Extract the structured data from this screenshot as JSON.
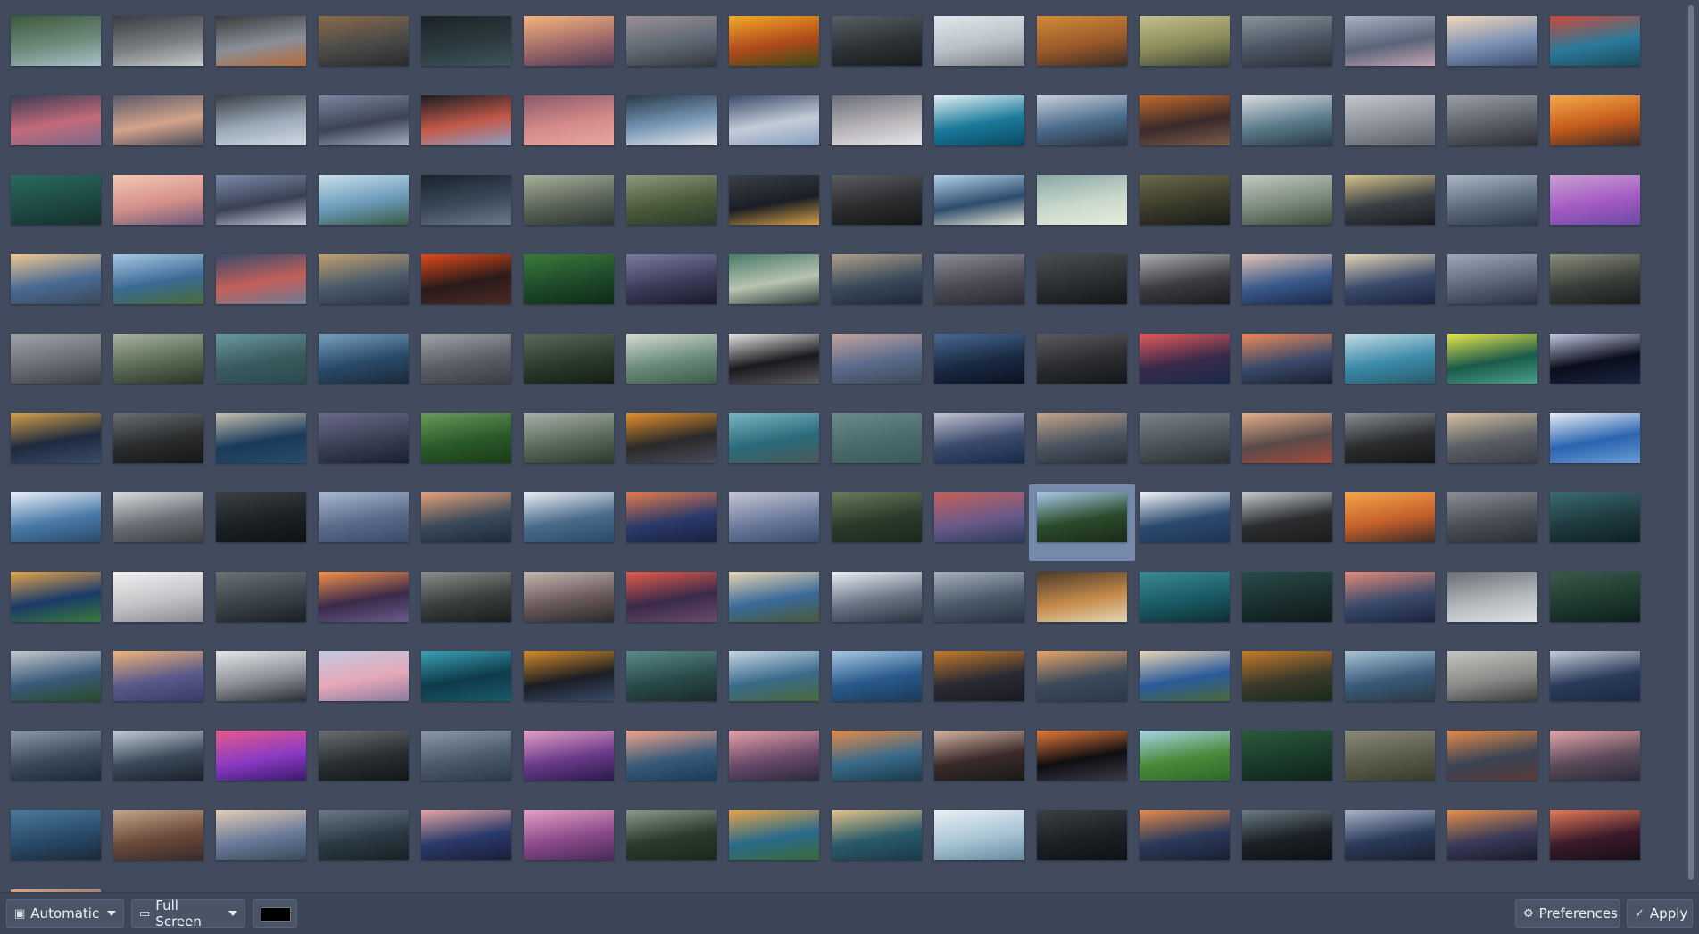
{
  "grid": {
    "selected_index": 106,
    "palette": [
      [
        "#6f8a7c",
        "#3c5a3c",
        "#a9c2c9"
      ],
      [
        "#7a7e82",
        "#3a3c3f",
        "#c9cbcc"
      ],
      [
        "#8a8f98",
        "#3b3a3b",
        "#b56a3a"
      ],
      [
        "#4a4a48",
        "#8a6a48",
        "#2c2a29"
      ],
      [
        "#2c3a40",
        "#1b2427",
        "#3f5459"
      ],
      [
        "#a06a6a",
        "#f4b47c",
        "#4a3a58"
      ],
      [
        "#5e6874",
        "#9a8f94",
        "#34383d"
      ],
      [
        "#b04a1a",
        "#f2a82a",
        "#3a4a1a"
      ],
      [
        "#2d3236",
        "#5a5e62",
        "#1a1c1e"
      ],
      [
        "#b8c0c8",
        "#e2e6ea",
        "#7a7e84"
      ],
      [
        "#9a5a2a",
        "#d48a3a",
        "#3a2c24"
      ],
      [
        "#8a8a5a",
        "#c2c08a",
        "#3c4436"
      ],
      [
        "#4a5460",
        "#8a949e",
        "#2a3038"
      ],
      [
        "#5a6478",
        "#a8b0c4",
        "#c4a4b4"
      ],
      [
        "#7a90b4",
        "#f2d8b8",
        "#3c4c6c"
      ],
      [
        "#2a7a9a",
        "#c84a3a",
        "#1c4a5a"
      ],
      [
        "#c46a7a",
        "#3a3c54",
        "#7a6a8a"
      ],
      [
        "#d4a48a",
        "#5a5a6a",
        "#4a4c5a"
      ],
      [
        "#9aaab8",
        "#3a3e44",
        "#d2dae2"
      ],
      [
        "#3c4454",
        "#7a86a0",
        "#a4aec0"
      ],
      [
        "#c45a4a",
        "#1a1c22",
        "#8aa0c4"
      ],
      [
        "#d48a8a",
        "#8a5a6a",
        "#e8a8a0"
      ],
      [
        "#7a9ab8",
        "#2a3a4a",
        "#e8e6ea"
      ],
      [
        "#c4ccd8",
        "#3a4c6a",
        "#8aa0c0"
      ],
      [
        "#b8b4b8",
        "#6a6e78",
        "#e6e6ea"
      ],
      [
        "#1a7a9a",
        "#e4f0f4",
        "#0a4a64"
      ],
      [
        "#4a6a8a",
        "#c8d0dc",
        "#2a3240"
      ],
      [
        "#3a2a2a",
        "#c46a2a",
        "#7a5a4a"
      ],
      [
        "#5a7a8a",
        "#d8dce0",
        "#2a3a44"
      ],
      [
        "#8a8e96",
        "#c4c8cc",
        "#5a5e66"
      ],
      [
        "#5a5e66",
        "#9a9ea4",
        "#2c2e32"
      ],
      [
        "#c45a1a",
        "#f4a84a",
        "#3a2a2a"
      ],
      [
        "#1e4a44",
        "#2a6a5c",
        "#14302c"
      ],
      [
        "#d4908a",
        "#f4c8b4",
        "#6a5a7a"
      ],
      [
        "#3a4054",
        "#7a8aa8",
        "#c4cad6"
      ],
      [
        "#6a9ab8",
        "#c8e0ec",
        "#3a5a44"
      ],
      [
        "#3a4a5a",
        "#1a222c",
        "#6a7a8a"
      ],
      [
        "#5a6458",
        "#a8b09c",
        "#2c3430"
      ],
      [
        "#4a5a3a",
        "#8a9a7a",
        "#2a3a2a"
      ],
      [
        "#1a1e24",
        "#3a4048",
        "#d4a04a"
      ],
      [
        "#2a2c2e",
        "#5a5c60",
        "#141618"
      ],
      [
        "#2c4c6c",
        "#b4d4ec",
        "#e8e4d4"
      ],
      [
        "#c8d8cc",
        "#8aa8a4",
        "#e8ecd8"
      ],
      [
        "#3a3a2a",
        "#6a6a4a",
        "#1a1c18"
      ],
      [
        "#7a8a7a",
        "#c4c8c4",
        "#3a4a3a"
      ],
      [
        "#3a3e44",
        "#d4c48a",
        "#1a1c20"
      ],
      [
        "#5a6a7a",
        "#a8b8c4",
        "#2a3a4a"
      ],
      [
        "#a45ac4",
        "#c8a0d0",
        "#6a4aa4"
      ],
      [
        "#4a6a94",
        "#f0c890",
        "#3a4a5a"
      ],
      [
        "#3a6a94",
        "#a8c8e4",
        "#4a6a3a"
      ],
      [
        "#c4605a",
        "#384a6a",
        "#6a7a94"
      ],
      [
        "#4a5a6a",
        "#c0a070",
        "#2a3444"
      ],
      [
        "#2a1a1a",
        "#e04a1a",
        "#4a2a24"
      ],
      [
        "#1e4a2a",
        "#3a7a3a",
        "#0e2a16"
      ],
      [
        "#3c3c5a",
        "#7a7aa0",
        "#1a1a2a"
      ],
      [
        "#b8c4b0",
        "#4a7a6a",
        "#2a3a3a"
      ],
      [
        "#3a4a5a",
        "#b0a08a",
        "#1c2838"
      ],
      [
        "#4a4a54",
        "#8a8a94",
        "#2a2a30"
      ],
      [
        "#2a2e30",
        "#4a4e50",
        "#141618"
      ],
      [
        "#3a3c40",
        "#aaacae",
        "#1a1c1e"
      ],
      [
        "#3a5a8a",
        "#e4c4b4",
        "#1a2a4a"
      ],
      [
        "#3a4a6a",
        "#e4d4b4",
        "#1a2440"
      ],
      [
        "#5a6478",
        "#a0a8b8",
        "#2a3040"
      ],
      [
        "#3a3e3a",
        "#8a8e7a",
        "#1a1e1a"
      ],
      [
        "#6a6e74",
        "#a0a4a8",
        "#3a3e44"
      ],
      [
        "#5a6a54",
        "#a8b4a0",
        "#2a3428"
      ],
      [
        "#3a5a5e",
        "#6a9a9e",
        "#2a4a4e"
      ],
      [
        "#2a4a6a",
        "#7aa0c0",
        "#1a2a3a"
      ],
      [
        "#5a5e64",
        "#a0a4a8",
        "#3a3e44"
      ],
      [
        "#2a3a2c",
        "#5a6a5a",
        "#141e16"
      ],
      [
        "#6a8a7a",
        "#d4dcd4",
        "#3a5a4a"
      ],
      [
        "#1a1a1e",
        "#e4e4e4",
        "#5a5a5e"
      ],
      [
        "#5a6a8a",
        "#c4a4a0",
        "#3a4a5a"
      ],
      [
        "#1a2a44",
        "#4a6a94",
        "#0a1222"
      ],
      [
        "#2a2c30",
        "#5a5c60",
        "#141618"
      ],
      [
        "#3a2a4a",
        "#e45a5a",
        "#1a2a4a"
      ],
      [
        "#3a4a6a",
        "#f08a5a",
        "#1a2030"
      ],
      [
        "#3a8aa8",
        "#c4dce4",
        "#2a5a6a"
      ],
      [
        "#1a5a4a",
        "#e8e84a",
        "#4aa08a"
      ],
      [
        "#0a0e1a",
        "#c4c8e4",
        "#1a2440"
      ],
      [
        "#1e2a3e",
        "#d4a04a",
        "#3a4a6a"
      ],
      [
        "#2a2c2e",
        "#6a6e70",
        "#141618"
      ],
      [
        "#1a3a5a",
        "#c8c0b0",
        "#2a4a6a"
      ],
      [
        "#3a4054",
        "#6a6a8a",
        "#1a2030"
      ],
      [
        "#2a5a2a",
        "#6a9a5a",
        "#1a3a1a"
      ],
      [
        "#5a6a5a",
        "#a8b0a8",
        "#2a3a2a"
      ],
      [
        "#2a2a2a",
        "#e4902a",
        "#4a4a5a"
      ],
      [
        "#2a6a7a",
        "#7ab4c4",
        "#4a5a5a"
      ],
      [
        "#4a6a6c",
        "#6a8a8c",
        "#3a5a5c"
      ],
      [
        "#3a4a6a",
        "#c4c4d4",
        "#1a2a4a"
      ],
      [
        "#4a5460",
        "#c4a48a",
        "#2a3038"
      ],
      [
        "#4a5458",
        "#7a8488",
        "#2a3034"
      ],
      [
        "#5a4a4a",
        "#e4b08a",
        "#a44a3a"
      ],
      [
        "#2a2c2e",
        "#8a8e90",
        "#141618"
      ],
      [
        "#5a5e64",
        "#d4c0a0",
        "#3a3e44"
      ],
      [
        "#2a64b0",
        "#e8eef6",
        "#6a9ad4"
      ],
      [
        "#4a7aa8",
        "#e8f0f8",
        "#2a4a6a"
      ],
      [
        "#6a6e74",
        "#d8dadc",
        "#3a3c40"
      ],
      [
        "#1a2024",
        "#3a4044",
        "#0e1214"
      ],
      [
        "#5a6a8a",
        "#a8b8d0",
        "#3a4a6a"
      ],
      [
        "#3a4a5a",
        "#e4a07a",
        "#1a2a3a"
      ],
      [
        "#4a6a8a",
        "#e8eef4",
        "#2a4a6a"
      ],
      [
        "#2a3a6a",
        "#e47a4a",
        "#1a2040"
      ],
      [
        "#6a7a9a",
        "#c4c4d4",
        "#3a4a6a"
      ],
      [
        "#2a3a2a",
        "#6a7a5a",
        "#1a2a1a"
      ],
      [
        "#6a5a8a",
        "#c4605a",
        "#2a3a5a"
      ],
      [
        "#2a4a2a",
        "#a8c8e4",
        "#1a2a1a"
      ],
      [
        "#2c4a6e",
        "#f0f4f8",
        "#1e3454"
      ],
      [
        "#2a2c2e",
        "#c4c8cc",
        "#1a1c1e"
      ],
      [
        "#c4602a",
        "#f4a44a",
        "#3a2a2a"
      ],
      [
        "#4a4e54",
        "#8a8e94",
        "#2a2e34"
      ],
      [
        "#1e3a3e",
        "#3a6a6e",
        "#0e2024"
      ],
      [
        "#1a3a6a",
        "#e4a44a",
        "#3a7a3a"
      ],
      [
        "#c4c4c8",
        "#f0f0f0",
        "#8a8a90"
      ],
      [
        "#3a4248",
        "#6a7278",
        "#1a2024"
      ],
      [
        "#3a2a4a",
        "#f4904a",
        "#6a5a8a"
      ],
      [
        "#3a3e3a",
        "#8a8e8a",
        "#1a1e1a"
      ],
      [
        "#6a5a5a",
        "#c4b4b0",
        "#2a2a2a"
      ],
      [
        "#3a2a4a",
        "#e45a4a",
        "#6a4a6a"
      ],
      [
        "#3a6a9a",
        "#e8d4b0",
        "#4a5a3a"
      ],
      [
        "#6a7484",
        "#e8eef4",
        "#2a3440"
      ],
      [
        "#4a5a6a",
        "#a8b0bc",
        "#2a3440"
      ],
      [
        "#c48a4a",
        "#4a3a2a",
        "#e4d4b4"
      ],
      [
        "#1a5a64",
        "#3a8a94",
        "#0e3034"
      ],
      [
        "#1a2e2e",
        "#2a4a4a",
        "#0e1a1a"
      ],
      [
        "#3a4a6a",
        "#e48a7a",
        "#1a2440"
      ],
      [
        "#b4b8bc",
        "#6a6e72",
        "#e0e2e4"
      ],
      [
        "#1e3a2e",
        "#3a5a4a",
        "#0e2018"
      ],
      [
        "#3a5a7a",
        "#c4c8cc",
        "#2a4a2a"
      ],
      [
        "#5a5a8a",
        "#f0b47a",
        "#3a3a6a"
      ],
      [
        "#8a8e94",
        "#e4e6e8",
        "#2a2e34"
      ],
      [
        "#e4a8b8",
        "#c4c8e0",
        "#8a7aa0"
      ],
      [
        "#0e3a4a",
        "#3aa0b4",
        "#1a5a6a"
      ],
      [
        "#1a1e24",
        "#d48a2a",
        "#3a4a6a"
      ],
      [
        "#2a4a4a",
        "#5a8a8a",
        "#1a2a2a"
      ],
      [
        "#3a6a8a",
        "#c4d4e4",
        "#4a6a3a"
      ],
      [
        "#2a5a8a",
        "#a8c8e4",
        "#1a3a5a"
      ],
      [
        "#2a2a34",
        "#c47a2a",
        "#1a1a20"
      ],
      [
        "#3a4a5a",
        "#e4a46a",
        "#2a3a4a"
      ],
      [
        "#2a5a9a",
        "#e8d4b4",
        "#4a6a3a"
      ],
      [
        "#3a3a2a",
        "#c47a2a",
        "#1a2a1a"
      ],
      [
        "#3a5a7a",
        "#a8c4d4",
        "#2a3a44"
      ],
      [
        "#8a8a88",
        "#c4c4c0",
        "#3a3a38"
      ],
      [
        "#2a3a5a",
        "#c4ccd8",
        "#1a2a44"
      ],
      [
        "#3a4a5a",
        "#8a9aaa",
        "#1a2a3a"
      ],
      [
        "#3a4a5a",
        "#c4ccd4",
        "#1a2028"
      ],
      [
        "#8a3ac4",
        "#e45a8a",
        "#3a1a6a"
      ],
      [
        "#2a2e30",
        "#6a6e70",
        "#141618"
      ],
      [
        "#4a5a6a",
        "#8a9aaa",
        "#2a3a4a"
      ],
      [
        "#6a3a8a",
        "#e4a0c4",
        "#2a1a4a"
      ],
      [
        "#3a5a7a",
        "#f0a48a",
        "#1a3a5a"
      ],
      [
        "#6a4a6a",
        "#e4a0a8",
        "#2a2a3a"
      ],
      [
        "#3a6a8a",
        "#e48a4a",
        "#1a3a4a"
      ],
      [
        "#3a2a2a",
        "#d4b4a4",
        "#1a1a1a"
      ],
      [
        "#0e0e12",
        "#e47a3a",
        "#3a3a44"
      ],
      [
        "#4a8a3a",
        "#a8d4e8",
        "#2a6a2a"
      ],
      [
        "#1a3a2a",
        "#2a5a3a",
        "#0e2418"
      ],
      [
        "#5a5a4a",
        "#8a8a7a",
        "#3a3a2a"
      ],
      [
        "#3a4454",
        "#e48a4a",
        "#5a3a3a"
      ],
      [
        "#5a4a5a",
        "#e4a4a8",
        "#2a2a3a"
      ],
      [
        "#2a4a6a",
        "#4a7a9a",
        "#1a2a3a"
      ],
      [
        "#6a4a3a",
        "#c4a48a",
        "#3a2a2a"
      ],
      [
        "#6a7a9a",
        "#e4ccb4",
        "#3a4a5a"
      ],
      [
        "#2a3a44",
        "#6a7a84",
        "#1a2024"
      ],
      [
        "#2a3a6a",
        "#e4a4a4",
        "#1a1e3a"
      ],
      [
        "#8a4a8a",
        "#e4a0c4",
        "#4a2a5a"
      ],
      [
        "#2a3a2a",
        "#8a9a8a",
        "#1a2a1a"
      ],
      [
        "#2a6a8a",
        "#e4a44a",
        "#3a6a3a"
      ],
      [
        "#2a5a6a",
        "#e4c48a",
        "#1a3a4a"
      ],
      [
        "#a8c4d4",
        "#e8f0f4",
        "#6a8aa0"
      ],
      [
        "#1a2024",
        "#3a4044",
        "#0e1216"
      ],
      [
        "#2a3a5a",
        "#e48a4a",
        "#1a2034"
      ],
      [
        "#1a2024",
        "#6a7a84",
        "#0e1216"
      ],
      [
        "#2a3a5a",
        "#a8b4c8",
        "#1a2030"
      ],
      [
        "#3a3a5a",
        "#e4904a",
        "#1a1a2a"
      ],
      [
        "#3a1a2a",
        "#e47a5a",
        "#1a0e18"
      ],
      [
        "#6a5a6a",
        "#e4a47a",
        "#2a2a3a"
      ]
    ]
  },
  "bottom_bar": {
    "position_mode": "Automatic",
    "position_icon": "picture-position-icon",
    "display_mode": "Full Screen",
    "display_icon": "monitor-icon",
    "background_color": "#000000",
    "preferences_label": "Preferences",
    "preferences_icon": "gear-icon",
    "apply_label": "Apply",
    "apply_icon": "checkmark-icon"
  }
}
